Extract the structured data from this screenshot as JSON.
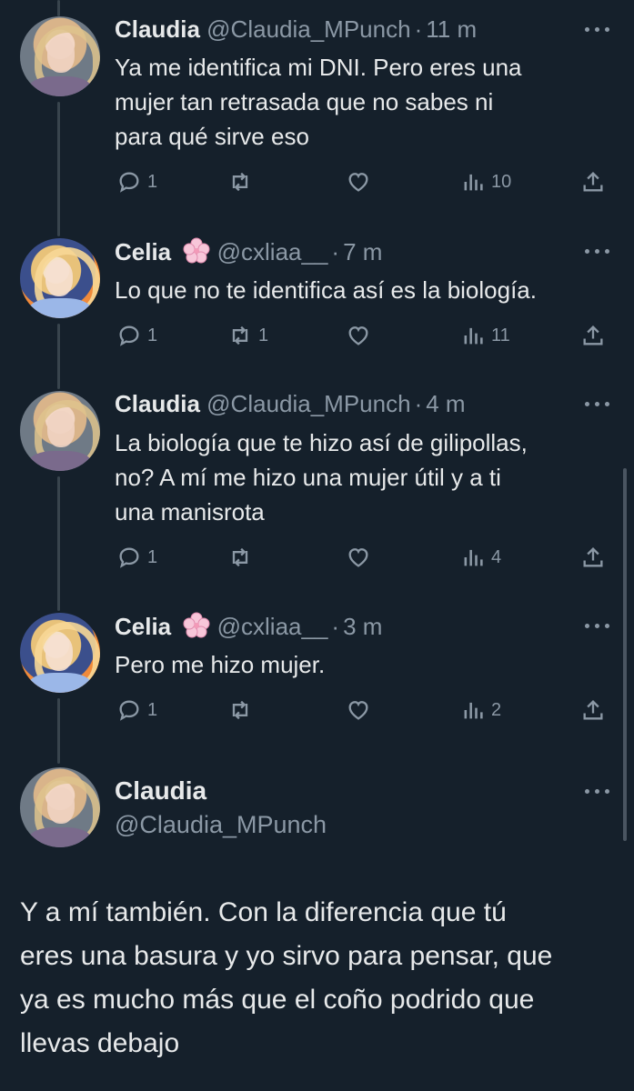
{
  "tweets": [
    {
      "name": "Claudia",
      "handle": "@Claudia_MPunch",
      "dot": "·",
      "time": "11 m",
      "text": [
        "Ya me identifica mi DNI. Pero  eres una",
        "mujer tan retrasada que no sabes ni",
        "para qué sirve eso"
      ],
      "replies": "1",
      "retweets": "",
      "likes": "",
      "views": "10"
    },
    {
      "name": "Celia",
      "handle": "@cxliaa__",
      "dot": "·",
      "time": "7 m",
      "text": [
        "Lo que no te identifica así es la biología."
      ],
      "replies": "1",
      "retweets": "1",
      "likes": "",
      "views": "11"
    },
    {
      "name": "Claudia",
      "handle": "@Claudia_MPunch",
      "dot": "·",
      "time": "4 m",
      "text": [
        "La biología que te hizo así de gilipollas,",
        "no? A mí me hizo una mujer útil y a ti",
        "una manisrota"
      ],
      "replies": "1",
      "retweets": "",
      "likes": "",
      "views": "4"
    },
    {
      "name": "Celia",
      "handle": "@cxliaa__",
      "dot": "·",
      "time": "3 m",
      "text": [
        "Pero me hizo mujer."
      ],
      "replies": "1",
      "retweets": "",
      "likes": "",
      "views": "2"
    }
  ],
  "main_tweet": {
    "name": "Claudia",
    "handle": "@Claudia_MPunch",
    "text": [
      "Y a mí también. Con la diferencia que tú",
      "eres una basura y yo sirvo para pensar, que",
      "ya es mucho más que el coño podrido que",
      "llevas debajo"
    ]
  },
  "icons": [
    "reply-icon",
    "retweet-icon",
    "like-icon",
    "views-icon",
    "share-icon",
    "more-icon",
    "cherry-blossom-icon"
  ],
  "colors": {
    "background": "#15202b",
    "text": "#e7e9ea",
    "secondary": "#8b98a5",
    "thread_line": "#38444d"
  }
}
